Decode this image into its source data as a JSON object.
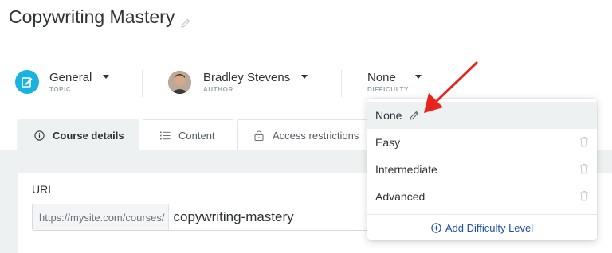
{
  "course": {
    "title": "Copywriting Mastery"
  },
  "meta": {
    "topic": {
      "value": "General",
      "caption": "TOPIC"
    },
    "author": {
      "value": "Bradley Stevens",
      "caption": "AUTHOR"
    },
    "difficulty": {
      "value": "None",
      "caption": "DIFFICULTY"
    }
  },
  "tabs": [
    {
      "label": "Course details",
      "icon": "info-circle-icon",
      "active": true
    },
    {
      "label": "Content",
      "icon": "list-icon",
      "active": false
    },
    {
      "label": "Access restrictions",
      "icon": "lock-icon",
      "active": false
    }
  ],
  "url_section": {
    "label": "URL",
    "prefix": "https://mysite.com/courses/",
    "slug": "copywriting-mastery"
  },
  "difficulty_dropdown": {
    "options": [
      {
        "label": "None",
        "selected": true,
        "action_icon": "pencil-icon"
      },
      {
        "label": "Easy",
        "selected": false,
        "action_icon": "trash-icon"
      },
      {
        "label": "Intermediate",
        "selected": false,
        "action_icon": "trash-icon"
      },
      {
        "label": "Advanced",
        "selected": false,
        "action_icon": "trash-icon"
      }
    ],
    "add_label": "Add Difficulty Level"
  },
  "colors": {
    "accent_blue": "#1ab3df",
    "link_blue": "#1f4fb0",
    "annotation_red": "#e8231b",
    "band_gray": "#eef1f1"
  }
}
